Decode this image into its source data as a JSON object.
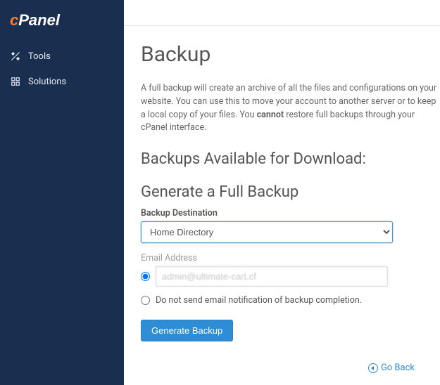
{
  "brand": "cPanel",
  "sidebar": {
    "items": [
      {
        "label": "Tools"
      },
      {
        "label": "Solutions"
      }
    ]
  },
  "page": {
    "title": "Backup",
    "desc_pre": "A full backup will create an archive of all the files and configurations on your website. You can use this to move your account to another server or to keep a local copy of your files. You ",
    "desc_bold": "cannot",
    "desc_post": " restore full backups through your cPanel interface."
  },
  "sections": {
    "available_title": "Backups Available for Download:",
    "generate_title": "Generate a Full Backup"
  },
  "form": {
    "dest_label": "Backup Destination",
    "dest_value": "Home Directory",
    "email_label": "Email Address",
    "email_value": "admin@ultimate-cart.cf",
    "no_notify_label": "Do not send email notification of backup completion.",
    "submit_label": "Generate Backup"
  },
  "go_back_label": "Go Back"
}
